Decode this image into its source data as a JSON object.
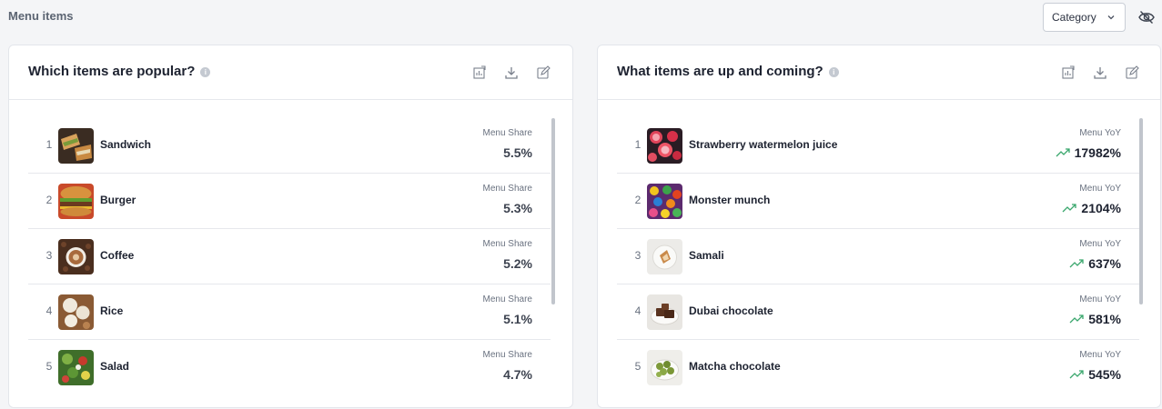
{
  "page": {
    "title": "Menu items"
  },
  "controls": {
    "category_label": "Category",
    "hide_icon": "eye-off-icon"
  },
  "popular": {
    "title": "Which items are popular?",
    "metric_label": "Menu Share",
    "items": [
      {
        "rank": "1",
        "name": "Sandwich",
        "value": "5.5%"
      },
      {
        "rank": "2",
        "name": "Burger",
        "value": "5.3%"
      },
      {
        "rank": "3",
        "name": "Coffee",
        "value": "5.2%"
      },
      {
        "rank": "4",
        "name": "Rice",
        "value": "5.1%"
      },
      {
        "rank": "5",
        "name": "Salad",
        "value": "4.7%"
      }
    ]
  },
  "upcoming": {
    "title": "What items are up and coming?",
    "metric_label": "Menu YoY",
    "items": [
      {
        "rank": "1",
        "name": "Strawberry watermelon juice",
        "value": "17982%"
      },
      {
        "rank": "2",
        "name": "Monster munch",
        "value": "2104%"
      },
      {
        "rank": "3",
        "name": "Samali",
        "value": "637%"
      },
      {
        "rank": "4",
        "name": "Dubai chocolate",
        "value": "581%"
      },
      {
        "rank": "5",
        "name": "Matcha chocolate",
        "value": "545%"
      }
    ]
  },
  "colors": {
    "trend_up": "#3aa76d",
    "border": "#e3e6eb",
    "background": "#f4f5f7"
  }
}
